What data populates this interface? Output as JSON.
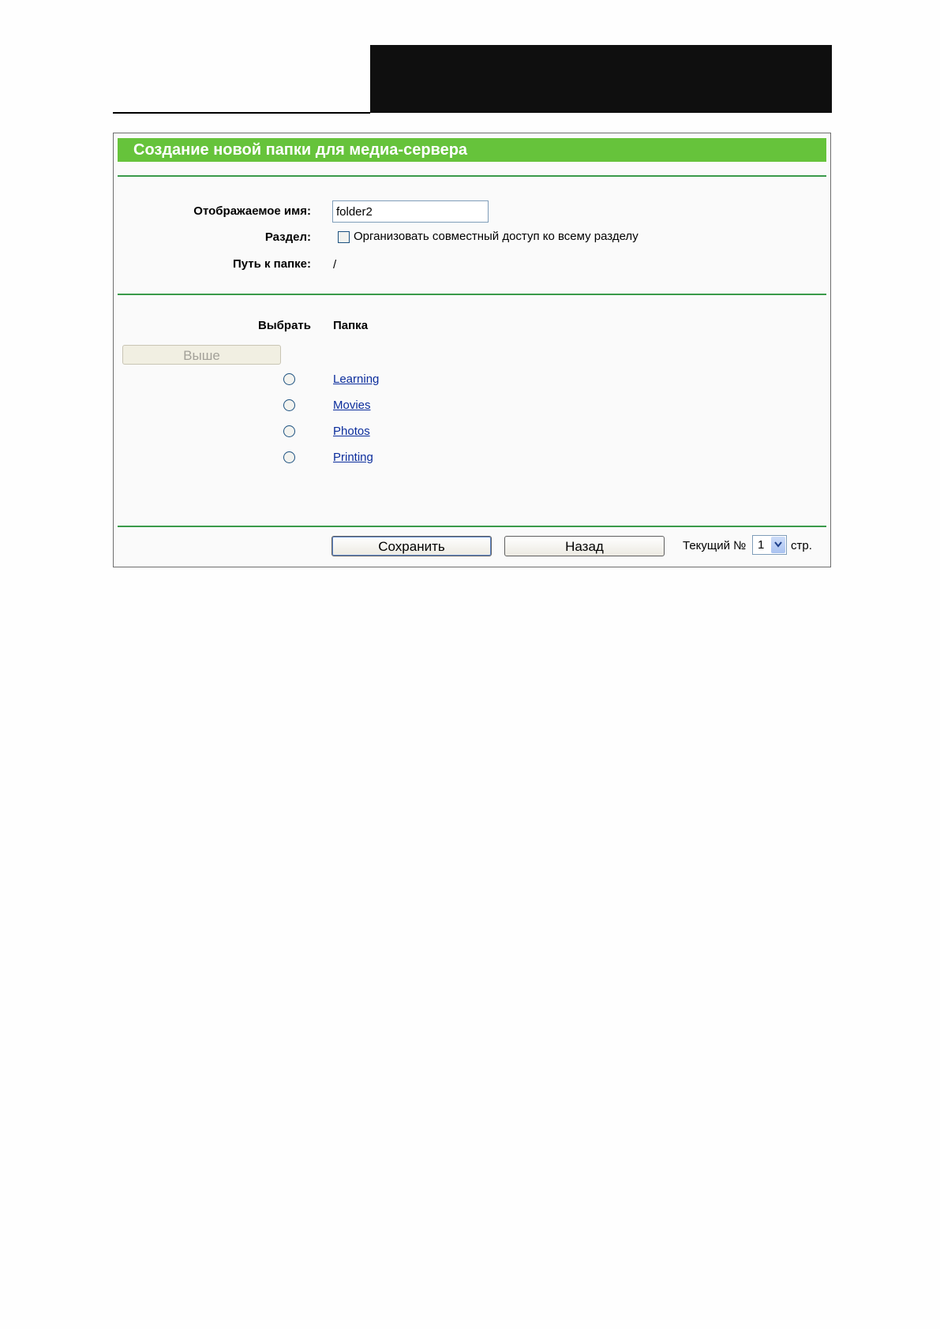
{
  "panel": {
    "title": "Создание новой папки для медиа-сервера"
  },
  "form": {
    "display_name_label": "Отображаемое имя:",
    "display_name_value": "folder2",
    "partition_label": "Раздел:",
    "partition_checkbox_label": "Организовать совместный доступ ко всему разделу",
    "partition_checked": false,
    "path_label": "Путь к папке:",
    "path_value": "/"
  },
  "folders": {
    "select_header": "Выбрать",
    "folder_header": "Папка",
    "up_button_label": "Выше",
    "items": [
      {
        "name": "Learning",
        "selected": false
      },
      {
        "name": "Movies",
        "selected": false
      },
      {
        "name": "Photos",
        "selected": false
      },
      {
        "name": "Printing",
        "selected": false
      }
    ]
  },
  "footer": {
    "save_label": "Сохранить",
    "back_label": "Назад",
    "current_page_label": "Текущий №",
    "current_page_value": "1",
    "page_suffix": "стр."
  },
  "colors": {
    "title_bar": "#66c33b",
    "separator": "#3a9a4a",
    "link": "#0b2d9c"
  },
  "icons": {
    "select_arrow": "chevron-down-icon"
  }
}
